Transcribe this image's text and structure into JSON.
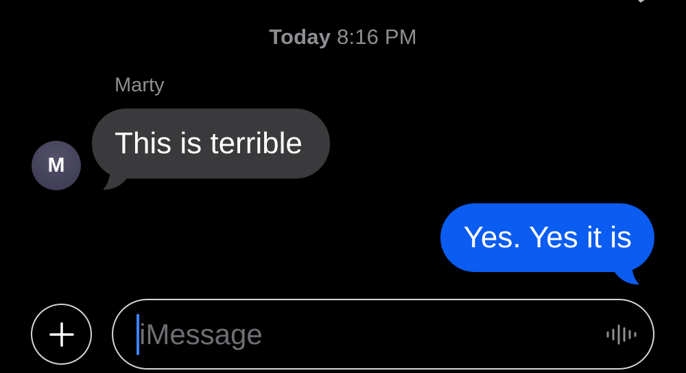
{
  "conversation": {
    "timestamp": {
      "day": "Today",
      "time": "8:16 PM"
    },
    "messages": [
      {
        "direction": "incoming",
        "sender": "Marty",
        "avatar_initial": "M",
        "text": "This is terrible"
      },
      {
        "direction": "outgoing",
        "text": "Yes. Yes it is"
      }
    ]
  },
  "composer": {
    "placeholder": "iMessage",
    "value": "",
    "add_icon": "plus-icon",
    "dictation_icon": "waveform-icon"
  },
  "colors": {
    "background": "#000000",
    "incoming_bubble": "#3a3a3c",
    "outgoing_bubble": "#0b5cf0",
    "secondary_text": "#8e8e93",
    "caret": "#3b82f6"
  }
}
